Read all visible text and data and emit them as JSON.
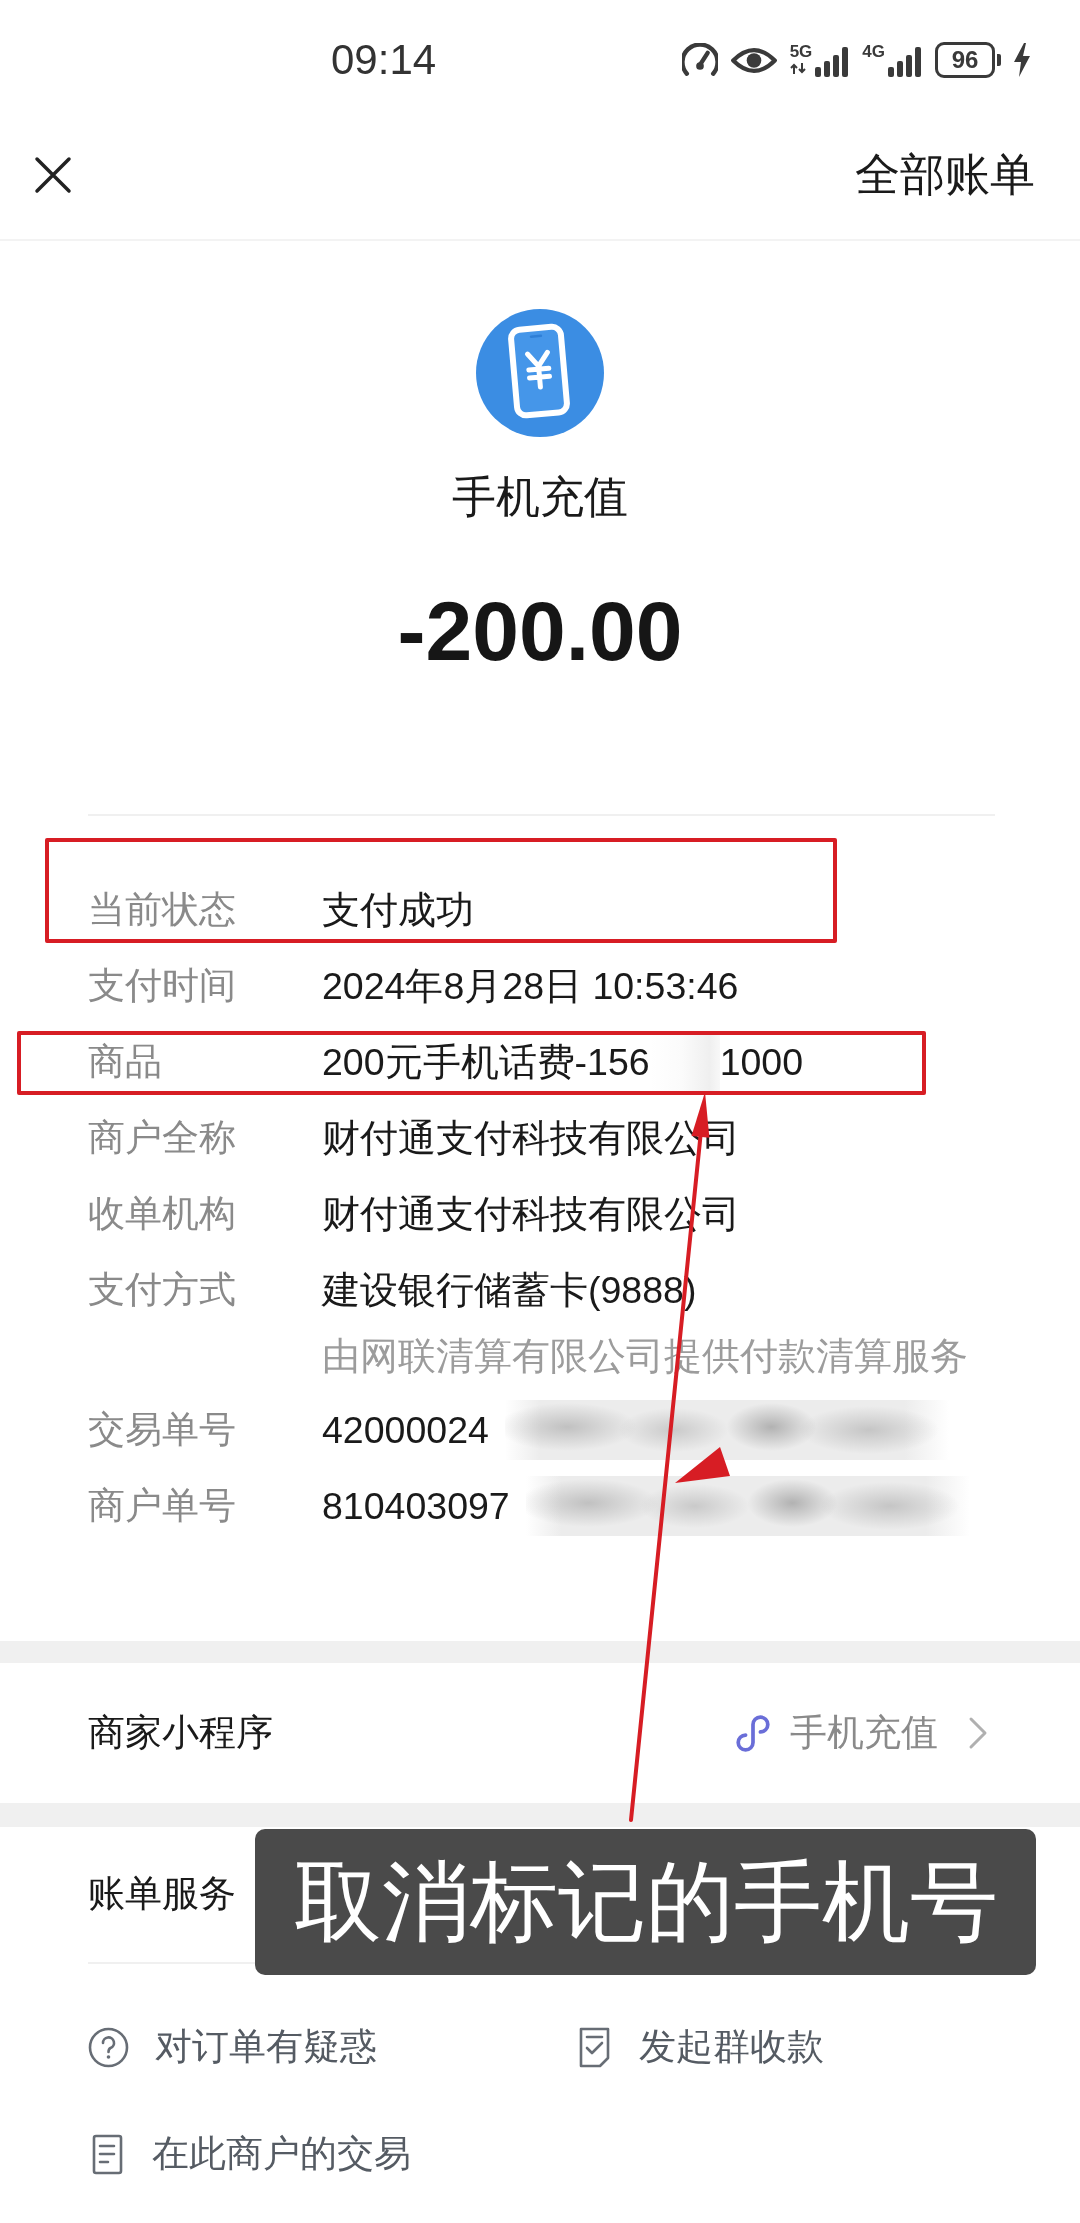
{
  "status_bar": {
    "time": "09:14",
    "networks": [
      {
        "label": "5G",
        "activity": true
      },
      {
        "label": "4G",
        "activity": false
      }
    ],
    "battery": "96",
    "charging": true
  },
  "header": {
    "action": "全部账单"
  },
  "summary": {
    "title": "手机充值",
    "amount": "-200.00"
  },
  "details": [
    {
      "label": "当前状态",
      "value": "支付成功",
      "highlighted": true,
      "redacted": false
    },
    {
      "label": "支付时间",
      "value": "2024年8月28日 10:53:46",
      "highlighted": false,
      "redacted": false
    },
    {
      "label": "商品",
      "value": "200元手机话费-156",
      "value_tail": "1000",
      "highlighted": true,
      "redacted": true
    },
    {
      "label": "商户全称",
      "value": "财付通支付科技有限公司",
      "highlighted": false,
      "redacted": false
    },
    {
      "label": "收单机构",
      "value": "财付通支付科技有限公司",
      "highlighted": false,
      "redacted": false
    },
    {
      "label": "支付方式",
      "value": "建设银行储蓄卡(9888)",
      "note": "由网联清算有限公司提供付款清算服务",
      "highlighted": false,
      "redacted": false
    },
    {
      "label": "交易单号",
      "value": "42000024",
      "highlighted": false,
      "redacted": true
    },
    {
      "label": "商户单号",
      "value": "810403097",
      "highlighted": false,
      "redacted": true
    }
  ],
  "mini_program": {
    "label": "商家小程序",
    "link_text": "手机充值"
  },
  "bill_services": {
    "label": "账单服务",
    "actions": [
      {
        "label": "对订单有疑惑",
        "kind": "question"
      },
      {
        "label": "发起群收款",
        "kind": "group-collect"
      },
      {
        "label": "在此商户的交易",
        "kind": "document"
      }
    ]
  },
  "annotation": {
    "caption": "取消标记的手机号",
    "marks": [
      {
        "kind": "arrow"
      },
      {
        "kind": "arrowhead"
      }
    ]
  }
}
